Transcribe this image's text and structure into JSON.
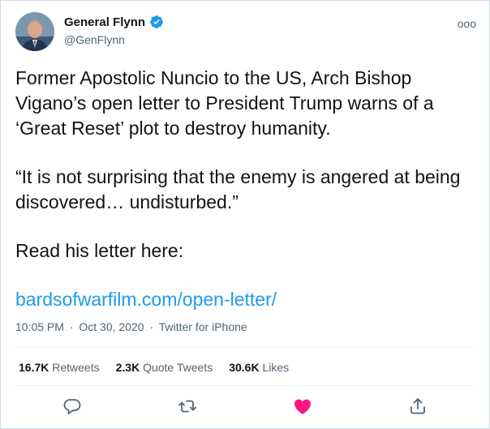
{
  "author": {
    "display_name": "General Flynn",
    "handle": "@GenFlynn",
    "verified_icon": "verified-badge-icon",
    "avatar_icon": "avatar"
  },
  "tweet": {
    "paragraph_1": "Former Apostolic Nuncio to the US, Arch Bishop Vigano’s open letter to President Trump warns of a ‘Great Reset’ plot to destroy humanity.",
    "paragraph_2": "“It is not surprising that the enemy is angered at being discovered… undisturbed.”",
    "paragraph_3": "Read his letter here:",
    "link": "bardsofwarfilm.com/open-letter/"
  },
  "meta": {
    "time": "10:05 PM",
    "date": "Oct 30, 2020",
    "source": "Twitter for iPhone",
    "separator": "·"
  },
  "stats": {
    "retweets_count": "16.7K",
    "retweets_label": "Retweets",
    "quotes_count": "2.3K",
    "quotes_label": "Quote Tweets",
    "likes_count": "30.6K",
    "likes_label": "Likes"
  },
  "more_icon_glyph": "ooo",
  "colors": {
    "link": "#1d9bf0",
    "like": "#f91880",
    "muted": "#536471",
    "verified": "#1d9bf0"
  },
  "icons": [
    "reply-icon",
    "retweet-icon",
    "like-icon",
    "share-icon",
    "more-icon"
  ]
}
